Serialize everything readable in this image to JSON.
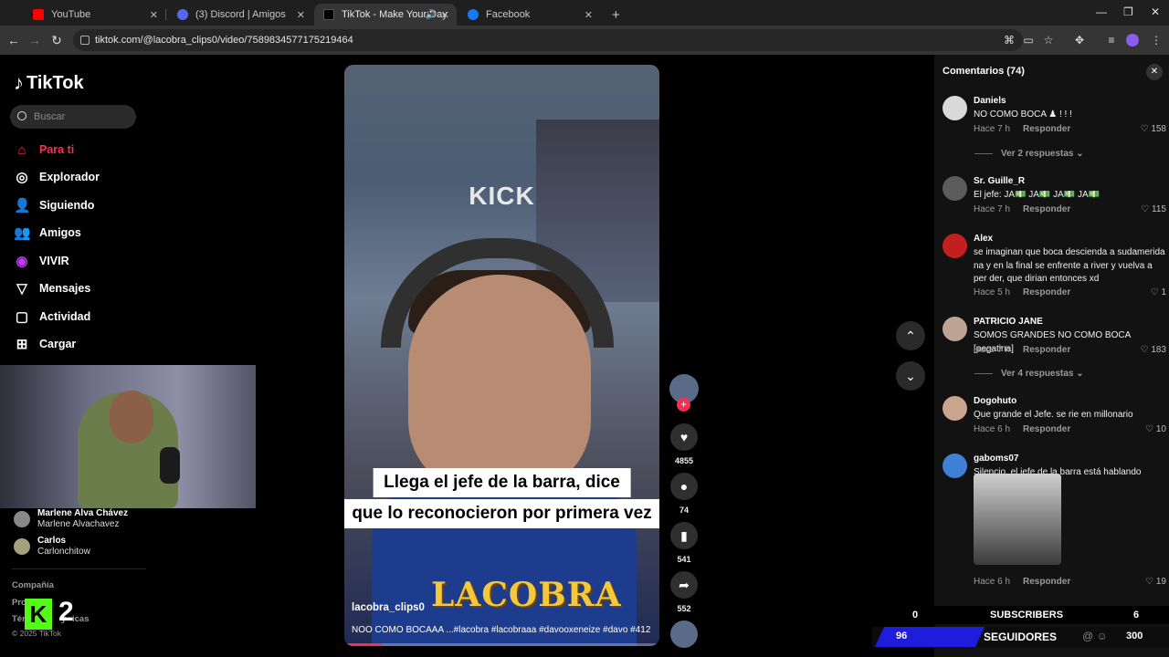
{
  "browser": {
    "tabs": [
      {
        "label": "YouTube",
        "color": "#ff0000"
      },
      {
        "label": "(3) Discord | Amigos",
        "color": "#5865f2"
      },
      {
        "label": "TikTok - Make Your Day",
        "color": "#000000"
      },
      {
        "label": "Facebook",
        "color": "#1877f2"
      }
    ],
    "url": "tiktok.com/@lacobra_clips0/video/7589834577175219464"
  },
  "sidebar": {
    "logo": "TikTok",
    "search_placeholder": "Buscar",
    "nav": [
      {
        "label": "Para ti",
        "icon": "home-icon"
      },
      {
        "label": "Explorador",
        "icon": "compass-icon"
      },
      {
        "label": "Siguiendo",
        "icon": "following-icon"
      },
      {
        "label": "Amigos",
        "icon": "friends-icon"
      },
      {
        "label": "VIVIR",
        "icon": "live-icon"
      },
      {
        "label": "Mensajes",
        "icon": "message-icon"
      },
      {
        "label": "Actividad",
        "icon": "activity-icon"
      },
      {
        "label": "Cargar",
        "icon": "upload-icon"
      }
    ],
    "following": [
      {
        "name": "Marlene Alva Chávez",
        "username": "Marlene Alvachavez"
      },
      {
        "name": "Carlos",
        "username": "Carlonchitow"
      }
    ],
    "footer": [
      "Compañía",
      "Pro",
      "Tér",
      "y",
      "icas",
      "© 2025 TikTok"
    ],
    "kick_count": "2"
  },
  "video": {
    "kick_text": "KICK",
    "caption_line1": "Llega el jefe de la barra, dice",
    "caption_line2": "que lo reconocieron por primera vez",
    "brand": "LACOBRA",
    "author": "lacobra_clips0",
    "description": "NOO COMO BOCAAA ...#lacobra #lacobraaa #davooxeneize #davo #412",
    "progress": 0.12
  },
  "actions": {
    "likes": "4855",
    "comments": "74",
    "saves": "541",
    "shares": "552"
  },
  "comments": {
    "title": "Comentarios (74)",
    "items": [
      {
        "user": "Daniels",
        "text": "NO COMO BOCA ♟ ! ! !",
        "time": "Hace 7 h",
        "reply": "Responder",
        "likes": "158",
        "replies": "Ver 2 respuestas"
      },
      {
        "user": "Sr. Guille_R",
        "text": "El jefe: JA💵 JA💵 JA💵 JA💵",
        "time": "Hace 7 h",
        "reply": "Responder",
        "likes": "115"
      },
      {
        "user": "Alex",
        "text": "se imaginan que boca descienda a sudamerida na y en la final se enfrente a river y vuelva a per der, que dirian entonces xd",
        "time": "Hace 5 h",
        "reply": "Responder",
        "likes": "1"
      },
      {
        "user": "PATRICIO JANE",
        "text": "SOMOS GRANDES NO COMO BOCA [pegatina]",
        "time": "Hace 7 h",
        "reply": "Responder",
        "likes": "183",
        "replies": "Ver 4 respuestas"
      },
      {
        "user": "Dogohuto",
        "text": "Que grande el Jefe. se rie en millonario",
        "time": "Hace 6 h",
        "reply": "Responder",
        "likes": "10"
      },
      {
        "user": "gaboms07",
        "text": "Silencio, el jefe de la barra está hablando",
        "time": "Hace 6 h",
        "reply": "Responder",
        "likes": "19"
      }
    ]
  },
  "overlay": {
    "subs_left": "0",
    "subs_label": "SUBSCRIBERS",
    "subs_right": "6",
    "follow_left": "96",
    "follow_label": "SEGUIDORES",
    "follow_right": "300"
  }
}
